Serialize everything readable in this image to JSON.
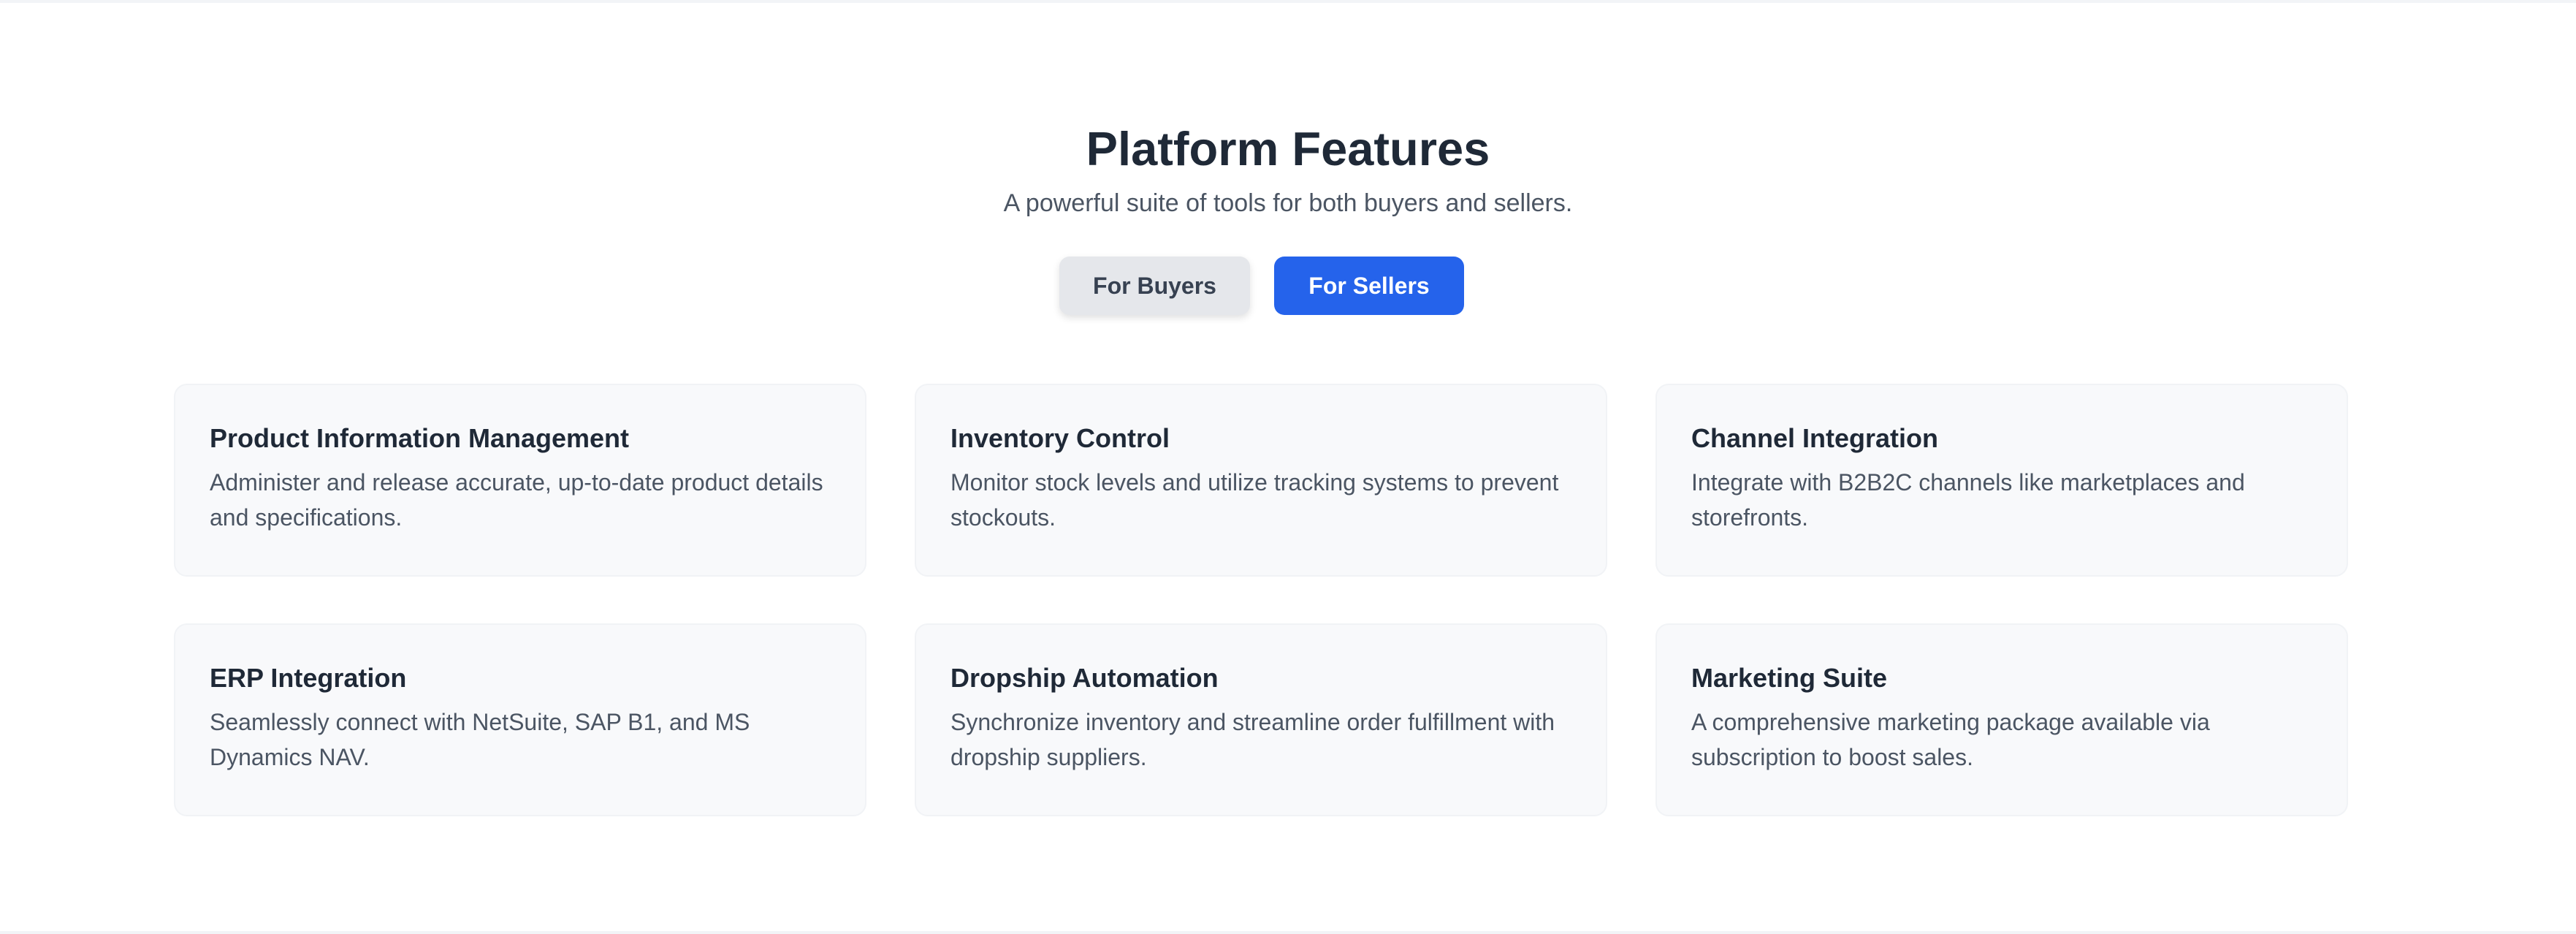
{
  "section": {
    "title": "Platform Features",
    "subtitle": "A powerful suite of tools for both buyers and sellers."
  },
  "tabs": {
    "buyers_label": "For Buyers",
    "sellers_label": "For Sellers",
    "active": "For Sellers"
  },
  "colors": {
    "accent": "#2563eb",
    "inactive_tab": "#e5e7eb",
    "card_background": "#f8f9fb",
    "heading_text": "#1f2937",
    "body_text": "#4b5563"
  },
  "features": [
    {
      "title": "Product Information Management",
      "description": "Administer and release accurate, up-to-date product details and specifications."
    },
    {
      "title": "Inventory Control",
      "description": "Monitor stock levels and utilize tracking systems to prevent stockouts."
    },
    {
      "title": "Channel Integration",
      "description": "Integrate with B2B2C channels like marketplaces and storefronts."
    },
    {
      "title": "ERP Integration",
      "description": "Seamlessly connect with NetSuite, SAP B1, and MS Dynamics NAV."
    },
    {
      "title": "Dropship Automation",
      "description": "Synchronize inventory and streamline order fulfillment with dropship suppliers."
    },
    {
      "title": "Marketing Suite",
      "description": "A comprehensive marketing package available via subscription to boost sales."
    }
  ]
}
